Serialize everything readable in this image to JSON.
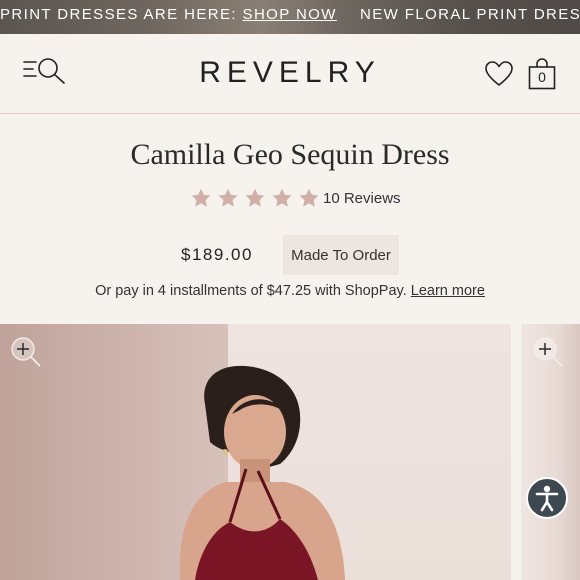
{
  "announcement": {
    "msg1_text": "PRINT DRESSES ARE HERE: ",
    "msg1_link": "SHOP NOW",
    "msg2_text": "NEW FLORAL PRINT DRESSES"
  },
  "header": {
    "logo": "REVELRY",
    "cart_count": "0",
    "icons": [
      "menu-search-icon",
      "heart-icon",
      "bag-icon"
    ]
  },
  "product": {
    "title": "Camilla Geo Sequin Dress",
    "rating_stars": 5,
    "reviews": "10 Reviews",
    "price": "$189.00",
    "badge": "Made To Order",
    "installments_text": "Or pay in 4 installments of $47.25 with ShopPay.",
    "learn_more": "Learn more"
  },
  "colors": {
    "accent_star": "#d3afa9",
    "divider": "#e3c9c3",
    "badge_bg": "#ece5e0",
    "page_bg": "#f6f3ef"
  }
}
